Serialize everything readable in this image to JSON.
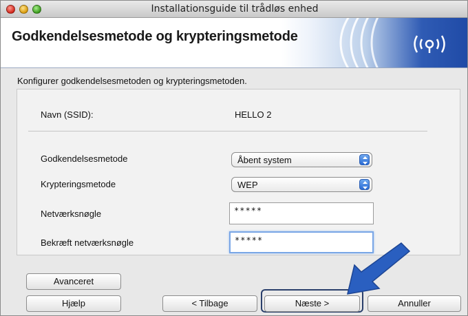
{
  "window": {
    "title": "Installationsguide til trådløs enhed"
  },
  "banner": {
    "title": "Godkendelsesmetode og krypteringsmetode",
    "logo_icon": "wireless-signal-icon"
  },
  "instruction": "Konfigurer godkendelsesmetoden og krypteringsmetoden.",
  "form": {
    "ssid_label": "Navn (SSID):",
    "ssid_value": "HELLO 2",
    "auth_label": "Godkendelsesmetode",
    "auth_value": "Åbent system",
    "encryption_label": "Krypteringsmetode",
    "encryption_value": "WEP",
    "key_label": "Netværksnøgle",
    "key_value": "*****",
    "confirm_label": "Bekræft netværksnøgle",
    "confirm_value": "*****"
  },
  "buttons": {
    "advanced": "Avanceret",
    "help": "Hjælp",
    "back": "< Tilbage",
    "next": "Næste >",
    "cancel": "Annuller"
  },
  "colors": {
    "accent_blue": "#2f5bb4",
    "pointer_arrow": "#2a5fc0"
  }
}
